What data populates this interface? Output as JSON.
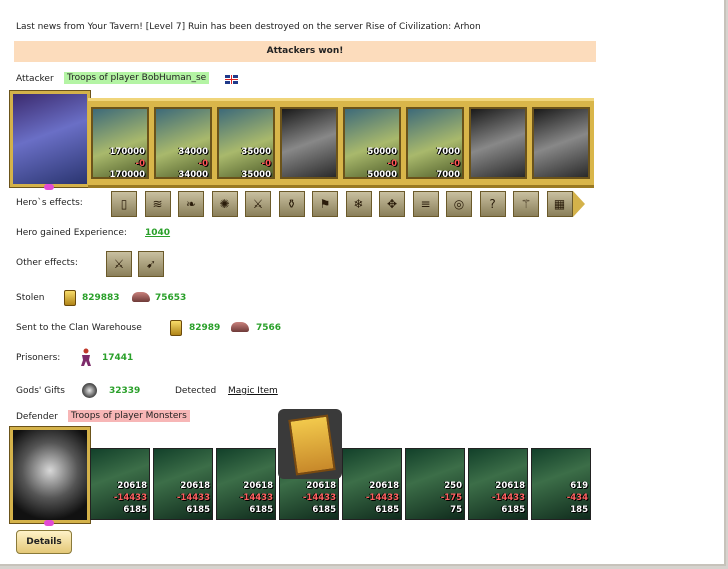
{
  "news": "Last news from Your Tavern! [Level 7] Ruin has been destroyed on the server Rise of Civilization: Arhon",
  "result_banner": "Attackers won!",
  "attacker": {
    "label": "Attacker",
    "troops_label": "Troops of player BobHuman_se",
    "units": [
      {
        "before": "170000",
        "lost": "-0",
        "after": "170000"
      },
      {
        "before": "34000",
        "lost": "-0",
        "after": "34000"
      },
      {
        "before": "35000",
        "lost": "-0",
        "after": "35000"
      },
      {
        "before": "",
        "lost": "",
        "after": ""
      },
      {
        "before": "50000",
        "lost": "-0",
        "after": "50000"
      },
      {
        "before": "7000",
        "lost": "-0",
        "after": "7000"
      },
      {
        "before": "",
        "lost": "",
        "after": ""
      },
      {
        "before": "",
        "lost": "",
        "after": ""
      }
    ]
  },
  "hero_effects_label": "Hero`s effects:",
  "hero_exp_label": "Hero gained Experience:",
  "hero_exp_value": "1040",
  "other_effects_label": "Other effects:",
  "stolen": {
    "label": "Stolen",
    "gold": "829883",
    "ore": "75653"
  },
  "clan": {
    "label": "Sent to the Clan Warehouse",
    "gold": "82989",
    "ore": "7566"
  },
  "prisoners": {
    "label": "Prisoners:",
    "value": "17441"
  },
  "gifts": {
    "label": "Gods' Gifts",
    "value": "32339",
    "detected_label": "Detected",
    "detected_link": "Magic Item"
  },
  "defender": {
    "label": "Defender",
    "troops_label": "Troops of player Monsters",
    "units": [
      {
        "before": "20618",
        "lost": "-14433",
        "after": "6185"
      },
      {
        "before": "20618",
        "lost": "-14433",
        "after": "6185"
      },
      {
        "before": "20618",
        "lost": "-14433",
        "after": "6185"
      },
      {
        "before": "20618",
        "lost": "-14433",
        "after": "6185"
      },
      {
        "before": "20618",
        "lost": "-14433",
        "after": "6185"
      },
      {
        "before": "250",
        "lost": "-175",
        "after": "75"
      },
      {
        "before": "20618",
        "lost": "-14433",
        "after": "6185"
      },
      {
        "before": "619",
        "lost": "-434",
        "after": "185"
      }
    ]
  },
  "details_button": "Details",
  "effect_icons": [
    "shield-door-icon",
    "wind-icon",
    "leaf-icon",
    "ice-orb-icon",
    "sword-icon",
    "potion-icon",
    "banner-icon",
    "frost-icon",
    "target-icon",
    "scroll-icon",
    "ring-icon",
    "question-icon",
    "staff-icon",
    "gate-icon"
  ],
  "other_effect_icons": [
    "dagger-icon",
    "horn-icon"
  ]
}
